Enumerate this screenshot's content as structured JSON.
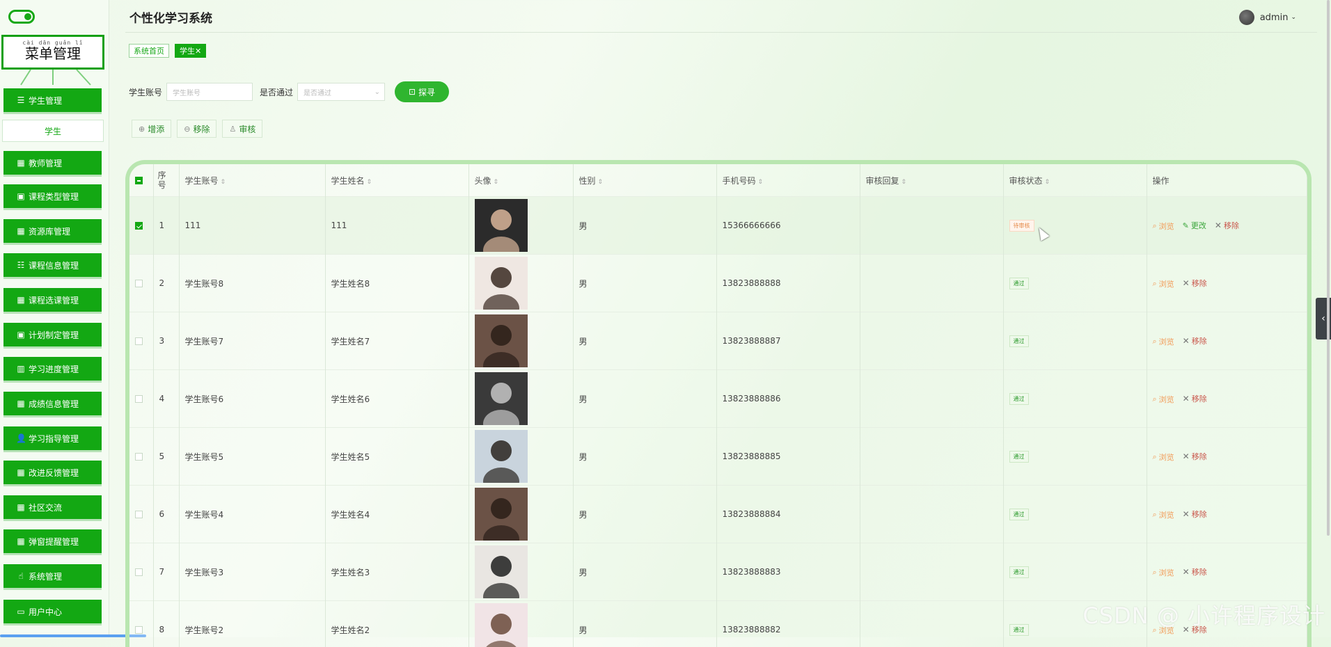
{
  "sidebar": {
    "menu_title_pinyin": "cài dān guǎn lǐ",
    "menu_title": "菜单管理",
    "active_submenu": "学生",
    "items": [
      {
        "label": "学生管理",
        "icon": "list-icon"
      },
      {
        "label": "教师管理",
        "icon": "grid-icon"
      },
      {
        "label": "课程类型管理",
        "icon": "clipboard-icon"
      },
      {
        "label": "资源库管理",
        "icon": "grid-icon"
      },
      {
        "label": "课程信息管理",
        "icon": "sliders-icon"
      },
      {
        "label": "课程选课管理",
        "icon": "grid-icon"
      },
      {
        "label": "计划制定管理",
        "icon": "clipboard-icon"
      },
      {
        "label": "学习进度管理",
        "icon": "chart-icon"
      },
      {
        "label": "成绩信息管理",
        "icon": "grid-icon"
      },
      {
        "label": "学习指导管理",
        "icon": "user-icon"
      },
      {
        "label": "改进反馈管理",
        "icon": "grid-icon"
      },
      {
        "label": "社区交流",
        "icon": "grid-icon"
      },
      {
        "label": "弹窗提醒管理",
        "icon": "grid-icon"
      },
      {
        "label": "系统管理",
        "icon": "thumb-icon"
      },
      {
        "label": "用户中心",
        "icon": "card-icon"
      }
    ]
  },
  "header": {
    "title": "个性化学习系统",
    "user": "admin"
  },
  "tabs": [
    {
      "label": "系统首页"
    },
    {
      "label": "学生✕"
    }
  ],
  "search": {
    "account_label": "学生账号",
    "account_placeholder": "学生账号",
    "pass_label": "是否通过",
    "pass_placeholder": "是否通过",
    "button": "探寻"
  },
  "actions": {
    "add": "增添",
    "remove": "移除",
    "audit": "审核"
  },
  "table": {
    "headers": [
      "序号",
      "学生账号",
      "学生姓名",
      "头像",
      "性别",
      "手机号码",
      "审核回复",
      "审核状态",
      "操作"
    ],
    "ops": {
      "view": "浏览",
      "edit": "更改",
      "del": "移除"
    },
    "rows": [
      {
        "no": "1",
        "account": "111",
        "name": "111",
        "gender": "男",
        "phone": "15366666666",
        "reply": "",
        "status": "待审核",
        "pending": true,
        "checked": true
      },
      {
        "no": "2",
        "account": "学生账号8",
        "name": "学生姓名8",
        "gender": "男",
        "phone": "13823888888",
        "reply": "",
        "status": "通过"
      },
      {
        "no": "3",
        "account": "学生账号7",
        "name": "学生姓名7",
        "gender": "男",
        "phone": "13823888887",
        "reply": "",
        "status": "通过"
      },
      {
        "no": "4",
        "account": "学生账号6",
        "name": "学生姓名6",
        "gender": "男",
        "phone": "13823888886",
        "reply": "",
        "status": "通过"
      },
      {
        "no": "5",
        "account": "学生账号5",
        "name": "学生姓名5",
        "gender": "男",
        "phone": "13823888885",
        "reply": "",
        "status": "通过"
      },
      {
        "no": "6",
        "account": "学生账号4",
        "name": "学生姓名4",
        "gender": "男",
        "phone": "13823888884",
        "reply": "",
        "status": "通过"
      },
      {
        "no": "7",
        "account": "学生账号3",
        "name": "学生姓名3",
        "gender": "男",
        "phone": "13823888883",
        "reply": "",
        "status": "通过"
      },
      {
        "no": "8",
        "account": "学生账号2",
        "name": "学生姓名2",
        "gender": "男",
        "phone": "13823888882",
        "reply": "",
        "status": "通过"
      }
    ]
  },
  "watermark": "CSDN @ 小许程序设计",
  "colors": {
    "primary": "#13a813",
    "view": "#f29b58",
    "delete": "#c9564b",
    "pending": "#e58b4b"
  }
}
